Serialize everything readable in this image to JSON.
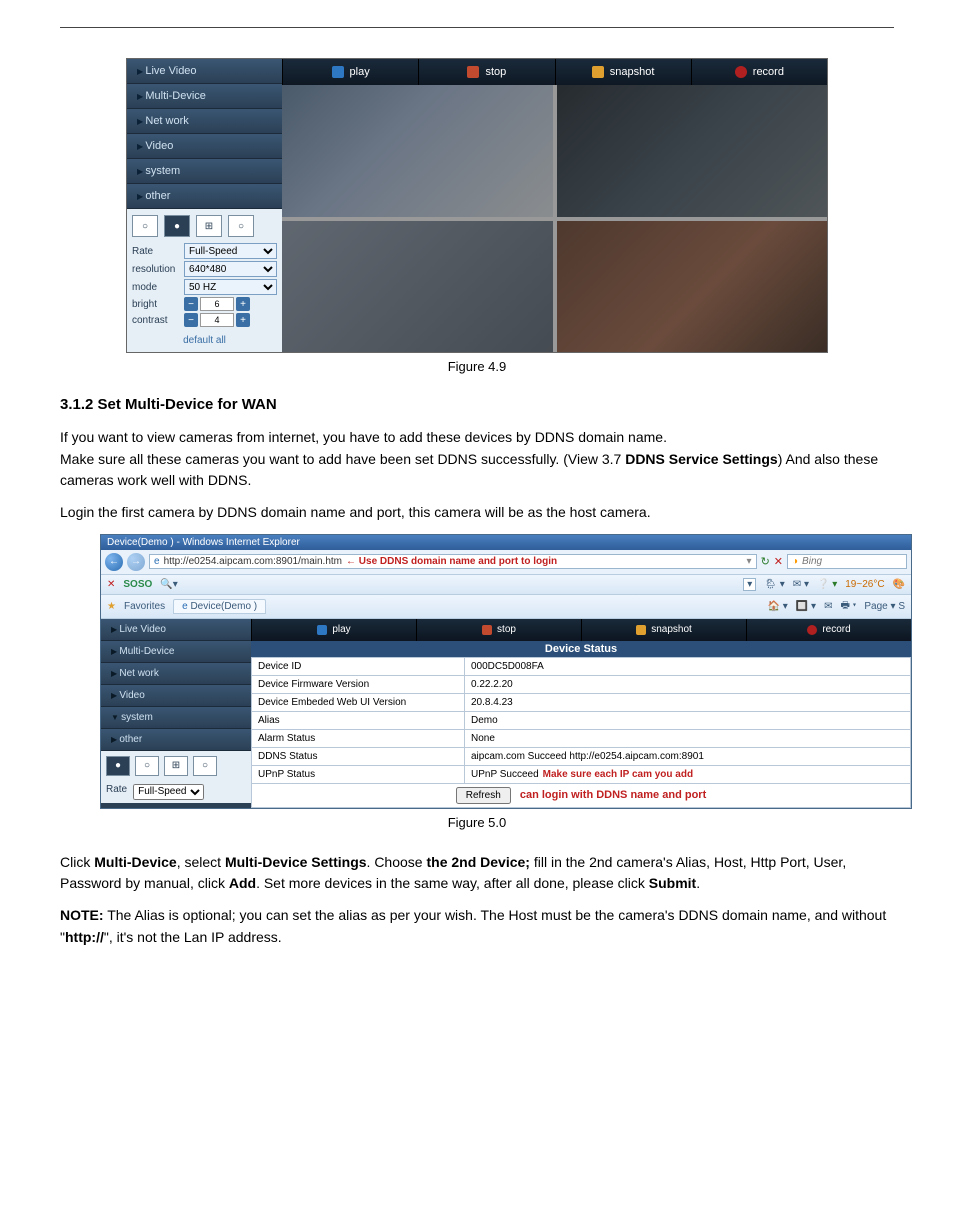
{
  "fig49": {
    "menu": [
      "Live Video",
      "Multi-Device",
      "Net work",
      "Video",
      "system",
      "other"
    ],
    "panel": {
      "rate_label": "Rate",
      "rate_value": "Full-Speed",
      "resolution_label": "resolution",
      "resolution_value": "640*480",
      "mode_label": "mode",
      "mode_value": "50 HZ",
      "bright_label": "bright",
      "bright_value": "6",
      "contrast_label": "contrast",
      "contrast_value": "4",
      "default_label": "default all"
    },
    "toolbar": {
      "play": "play",
      "stop": "stop",
      "snapshot": "snapshot",
      "record": "record"
    },
    "caption": "Figure 4.9"
  },
  "section": {
    "heading": "3.1.2 Set Multi-Device for WAN",
    "p1a": "If you want to view cameras from internet, you have to add these devices by DDNS domain name.",
    "p1b_pre": "Make sure all these cameras you want to add have been set DDNS successfully. (View 3.7 ",
    "p1b_bold": "DDNS Service Settings",
    "p1b_post": ") And also these cameras work well with DDNS.",
    "p2": "Login the first camera by DDNS domain name and port, this camera will be as the host camera."
  },
  "fig50": {
    "titlebar": "Device(Demo ) - Windows Internet Explorer",
    "address": "http://e0254.aipcam.com:8901/main.htm",
    "address_tip": "Use DDNS domain name and port to login",
    "search_placeholder": "Bing",
    "toolbar_temp": "19~26°C",
    "fav_label": "Favorites",
    "fav_tab": "Device(Demo )",
    "page_menu": "Page ▾   S",
    "menu": [
      "Live Video",
      "Multi-Device",
      "Net work",
      "Video",
      "system",
      "other"
    ],
    "rate_label": "Rate",
    "rate_value": "Full-Speed",
    "toolbar": {
      "play": "play",
      "stop": "stop",
      "snapshot": "snapshot",
      "record": "record"
    },
    "device_status": {
      "header": "Device Status",
      "rows": [
        {
          "k": "Device ID",
          "v": "000DC5D008FA"
        },
        {
          "k": "Device Firmware Version",
          "v": "0.22.2.20"
        },
        {
          "k": "Device Embeded Web UI Version",
          "v": "20.8.4.23"
        },
        {
          "k": "Alias",
          "v": "Demo"
        },
        {
          "k": "Alarm Status",
          "v": "None"
        },
        {
          "k": "DDNS Status",
          "v": "aipcam.com  Succeed  http://e0254.aipcam.com:8901"
        },
        {
          "k": "UPnP Status",
          "v": "UPnP Succeed"
        }
      ],
      "annot1": "Make sure each IP cam you add",
      "refresh_label": "Refresh",
      "annot2": "can login with DDNS name and port"
    },
    "caption": "Figure 5.0"
  },
  "tail": {
    "t1_a": "Click ",
    "t1_b": "Multi-Device",
    "t1_c": ", select ",
    "t1_d": "Multi-Device Settings",
    "t1_e": ". Choose ",
    "t1_f": "the 2nd Device;",
    "t1_g": " fill in the 2nd camera's Alias, Host, Http Port, User, Password by manual, click ",
    "t1_h": "Add",
    "t1_i": ". Set more devices in the same way, after all done, please click ",
    "t1_j": "Submit",
    "t1_k": ".",
    "t2_a": "NOTE:",
    "t2_b": " The Alias is optional; you can set the alias as per your wish. The Host must be the camera's DDNS domain name, and without \"",
    "t2_c": "http://",
    "t2_d": "\", it's not the Lan IP address."
  }
}
